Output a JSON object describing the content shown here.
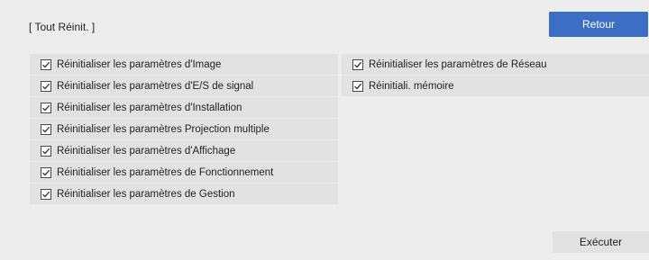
{
  "header": {
    "title": "[ Tout Réinit. ]",
    "back_label": "Retour"
  },
  "left_items": [
    {
      "label": "Réinitialiser les paramètres d'Image",
      "checked": true
    },
    {
      "label": "Réinitialiser les paramètres d'E/S de signal",
      "checked": true
    },
    {
      "label": "Réinitialiser les paramètres d'Installation",
      "checked": true
    },
    {
      "label": "Réinitialiser les paramètres Projection multiple",
      "checked": true
    },
    {
      "label": "Réinitialiser les paramètres d'Affichage",
      "checked": true
    },
    {
      "label": "Réinitialiser les paramètres de Fonctionnement",
      "checked": true
    },
    {
      "label": "Réinitialiser les paramètres de Gestion",
      "checked": true
    }
  ],
  "right_items": [
    {
      "label": "Réinitialiser les paramètres de Réseau",
      "checked": true
    },
    {
      "label": "Réinitiali. mémoire",
      "checked": true
    }
  ],
  "footer": {
    "execute_label": "Exécuter"
  },
  "colors": {
    "background": "#ededed",
    "item_background": "#e2e2e2",
    "accent_button": "#3c6fc4"
  }
}
